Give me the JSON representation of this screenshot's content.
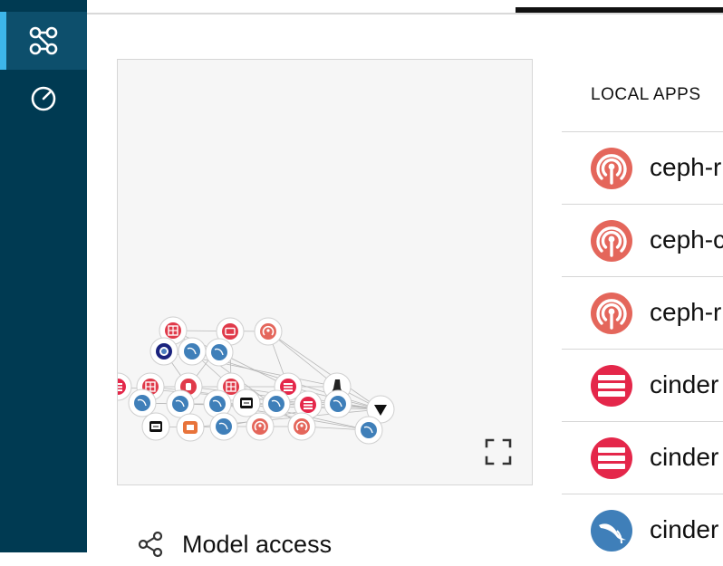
{
  "sidebar": {
    "items": [
      {
        "icon": "model-graph-icon",
        "active": true
      },
      {
        "icon": "gauge-icon",
        "active": false
      }
    ]
  },
  "model_access": {
    "label": "Model access",
    "icon": "share-icon"
  },
  "local_apps": {
    "title": "LOCAL APPS",
    "items": [
      {
        "name": "ceph-r",
        "icon": "ceph-icon"
      },
      {
        "name": "ceph-c",
        "icon": "ceph-icon"
      },
      {
        "name": "ceph-r",
        "icon": "ceph-icon"
      },
      {
        "name": "cinder",
        "icon": "cinder-icon"
      },
      {
        "name": "cinder",
        "icon": "cinder-icon"
      },
      {
        "name": "cinder",
        "icon": "mysql-icon"
      }
    ]
  },
  "graph": {
    "expand_icon": "fullscreen-icon",
    "node_types": [
      "ceph",
      "cinder",
      "mysql",
      "keystone",
      "glance",
      "nova",
      "charm",
      "ubuntu",
      "maas",
      "vault",
      "ntp"
    ]
  },
  "colors": {
    "sidebar_bg": "#003a52",
    "sidebar_active": "#0d4f6c",
    "accent": "#3db6ea",
    "ceph": "#e4665b",
    "cinder": "#e4274a",
    "mysql": "#3f7fb9"
  }
}
